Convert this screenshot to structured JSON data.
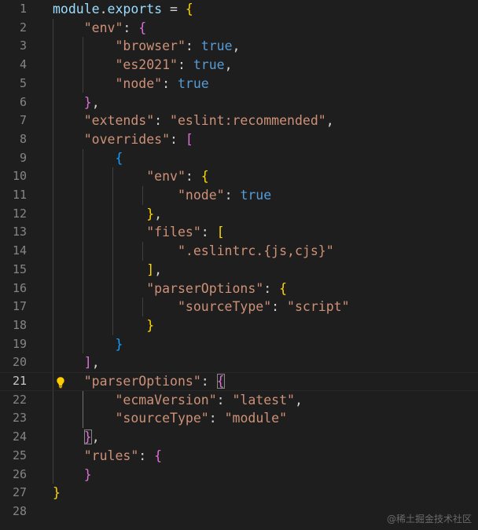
{
  "editor": {
    "current_line": 21,
    "colors": {
      "background": "#1e1e1e",
      "line_number": "#858585",
      "key": "#9cdcfe",
      "string": "#ce9178",
      "boolean": "#569cd6",
      "bracket_level1": "#ffd700",
      "bracket_level2": "#da70d6",
      "bracket_level3": "#179fff"
    },
    "icons": {
      "lightbulb": "lightbulb-icon"
    },
    "lines": [
      {
        "n": "1",
        "t": [
          [
            "tok-id",
            "module"
          ],
          [
            "tok-op",
            "."
          ],
          [
            "tok-id",
            "exports"
          ],
          [
            "tok-op",
            " = "
          ],
          [
            "b1",
            "{"
          ]
        ]
      },
      {
        "n": "2",
        "t": [
          [
            "tok-op",
            "    "
          ],
          [
            "tok-str",
            "\"env\""
          ],
          [
            "tok-op",
            ": "
          ],
          [
            "b2",
            "{"
          ]
        ]
      },
      {
        "n": "3",
        "t": [
          [
            "tok-op",
            "        "
          ],
          [
            "tok-str",
            "\"browser\""
          ],
          [
            "tok-op",
            ": "
          ],
          [
            "tok-bool",
            "true"
          ],
          [
            "tok-op",
            ","
          ]
        ]
      },
      {
        "n": "4",
        "t": [
          [
            "tok-op",
            "        "
          ],
          [
            "tok-str",
            "\"es2021\""
          ],
          [
            "tok-op",
            ": "
          ],
          [
            "tok-bool",
            "true"
          ],
          [
            "tok-op",
            ","
          ]
        ]
      },
      {
        "n": "5",
        "t": [
          [
            "tok-op",
            "        "
          ],
          [
            "tok-str",
            "\"node\""
          ],
          [
            "tok-op",
            ": "
          ],
          [
            "tok-bool",
            "true"
          ]
        ]
      },
      {
        "n": "6",
        "t": [
          [
            "tok-op",
            "    "
          ],
          [
            "b2",
            "}"
          ],
          [
            "tok-op",
            ","
          ]
        ]
      },
      {
        "n": "7",
        "t": [
          [
            "tok-op",
            "    "
          ],
          [
            "tok-str",
            "\"extends\""
          ],
          [
            "tok-op",
            ": "
          ],
          [
            "tok-str",
            "\"eslint:recommended\""
          ],
          [
            "tok-op",
            ","
          ]
        ]
      },
      {
        "n": "8",
        "t": [
          [
            "tok-op",
            "    "
          ],
          [
            "tok-str",
            "\"overrides\""
          ],
          [
            "tok-op",
            ": "
          ],
          [
            "b2",
            "["
          ]
        ]
      },
      {
        "n": "9",
        "t": [
          [
            "tok-op",
            "        "
          ],
          [
            "b3",
            "{"
          ]
        ]
      },
      {
        "n": "10",
        "t": [
          [
            "tok-op",
            "            "
          ],
          [
            "tok-str",
            "\"env\""
          ],
          [
            "tok-op",
            ": "
          ],
          [
            "b1",
            "{"
          ]
        ]
      },
      {
        "n": "11",
        "t": [
          [
            "tok-op",
            "                "
          ],
          [
            "tok-str",
            "\"node\""
          ],
          [
            "tok-op",
            ": "
          ],
          [
            "tok-bool",
            "true"
          ]
        ]
      },
      {
        "n": "12",
        "t": [
          [
            "tok-op",
            "            "
          ],
          [
            "b1",
            "}"
          ],
          [
            "tok-op",
            ","
          ]
        ]
      },
      {
        "n": "13",
        "t": [
          [
            "tok-op",
            "            "
          ],
          [
            "tok-str",
            "\"files\""
          ],
          [
            "tok-op",
            ": "
          ],
          [
            "b1",
            "["
          ]
        ]
      },
      {
        "n": "14",
        "t": [
          [
            "tok-op",
            "                "
          ],
          [
            "tok-str",
            "\".eslintrc.{js,cjs}\""
          ]
        ]
      },
      {
        "n": "15",
        "t": [
          [
            "tok-op",
            "            "
          ],
          [
            "b1",
            "]"
          ],
          [
            "tok-op",
            ","
          ]
        ]
      },
      {
        "n": "16",
        "t": [
          [
            "tok-op",
            "            "
          ],
          [
            "tok-str",
            "\"parserOptions\""
          ],
          [
            "tok-op",
            ": "
          ],
          [
            "b1",
            "{"
          ]
        ]
      },
      {
        "n": "17",
        "t": [
          [
            "tok-op",
            "                "
          ],
          [
            "tok-str",
            "\"sourceType\""
          ],
          [
            "tok-op",
            ": "
          ],
          [
            "tok-str",
            "\"script\""
          ]
        ]
      },
      {
        "n": "18",
        "t": [
          [
            "tok-op",
            "            "
          ],
          [
            "b1",
            "}"
          ]
        ]
      },
      {
        "n": "19",
        "t": [
          [
            "tok-op",
            "        "
          ],
          [
            "b3",
            "}"
          ]
        ]
      },
      {
        "n": "20",
        "t": [
          [
            "tok-op",
            "    "
          ],
          [
            "b2",
            "]"
          ],
          [
            "tok-op",
            ","
          ]
        ]
      },
      {
        "n": "21",
        "t": [
          [
            "tok-op",
            "    "
          ],
          [
            "tok-str",
            "\"parserOptions\""
          ],
          [
            "tok-op",
            ": "
          ],
          [
            "b2",
            "{"
          ]
        ]
      },
      {
        "n": "22",
        "t": [
          [
            "tok-op",
            "        "
          ],
          [
            "tok-str",
            "\"ecmaVersion\""
          ],
          [
            "tok-op",
            ": "
          ],
          [
            "tok-str",
            "\"latest\""
          ],
          [
            "tok-op",
            ","
          ]
        ]
      },
      {
        "n": "23",
        "t": [
          [
            "tok-op",
            "        "
          ],
          [
            "tok-str",
            "\"sourceType\""
          ],
          [
            "tok-op",
            ": "
          ],
          [
            "tok-str",
            "\"module\""
          ]
        ]
      },
      {
        "n": "24",
        "t": [
          [
            "tok-op",
            "    "
          ],
          [
            "b2",
            "}"
          ],
          [
            "tok-op",
            ","
          ]
        ]
      },
      {
        "n": "25",
        "t": [
          [
            "tok-op",
            "    "
          ],
          [
            "tok-str",
            "\"rules\""
          ],
          [
            "tok-op",
            ": "
          ],
          [
            "b2",
            "{"
          ]
        ]
      },
      {
        "n": "26",
        "t": [
          [
            "tok-op",
            "    "
          ],
          [
            "b2",
            "}"
          ]
        ]
      },
      {
        "n": "27",
        "t": [
          [
            "b1",
            "}"
          ]
        ]
      },
      {
        "n": "28",
        "t": []
      }
    ]
  },
  "watermark": "@稀土掘金技术社区"
}
